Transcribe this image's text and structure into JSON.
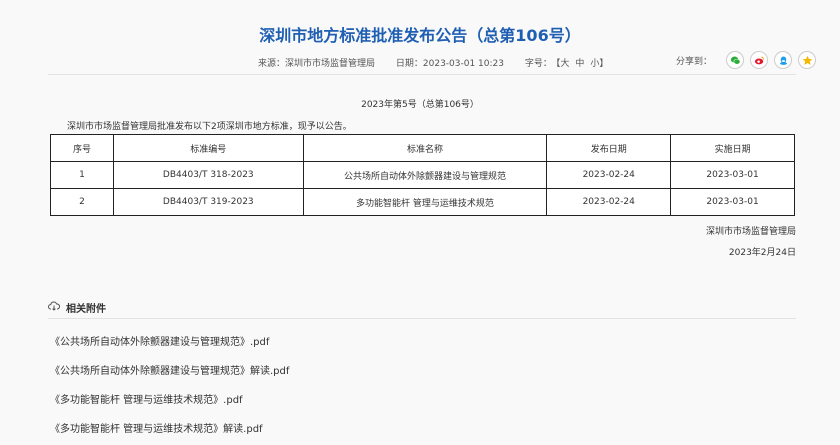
{
  "title": "深圳市地方标准批准发布公告（总第106号）",
  "meta": {
    "source": "来源：深圳市市场监督管理局",
    "date": "日期：2023-03-01 10:23",
    "font_label": "字号：",
    "sizes": [
      "【大",
      "中",
      "小】"
    ]
  },
  "share": {
    "label": "分享到：",
    "icons": [
      "wechat-icon",
      "weibo-icon",
      "qq-icon",
      "qzone-icon"
    ]
  },
  "notice_no": "2023年第5号（总第106号）",
  "intro": "深圳市市场监督管理局批准发布以下2项深圳市地方标准，现予以公告。",
  "table": {
    "headers": [
      "序号",
      "标准编号",
      "标准名称",
      "发布日期",
      "实施日期"
    ],
    "rows": [
      [
        "1",
        "DB4403/T 318-2023",
        "公共场所自动体外除颤器建设与管理规范",
        "2023-02-24",
        "2023-03-01"
      ],
      [
        "2",
        "DB4403/T 319-2023",
        "多功能智能杆 管理与运维技术规范",
        "2023-02-24",
        "2023-03-01"
      ]
    ]
  },
  "signature": {
    "org": "深圳市市场监督管理局",
    "date": "2023年2月24日"
  },
  "attachments": {
    "heading": "相关附件",
    "items": [
      "《公共场所自动体外除颤器建设与管理规范》.pdf",
      "《公共场所自动体外除颤器建设与管理规范》解读.pdf",
      "《多功能智能杆 管理与运维技术规范》.pdf",
      "《多功能智能杆 管理与运维技术规范》解读.pdf"
    ]
  }
}
